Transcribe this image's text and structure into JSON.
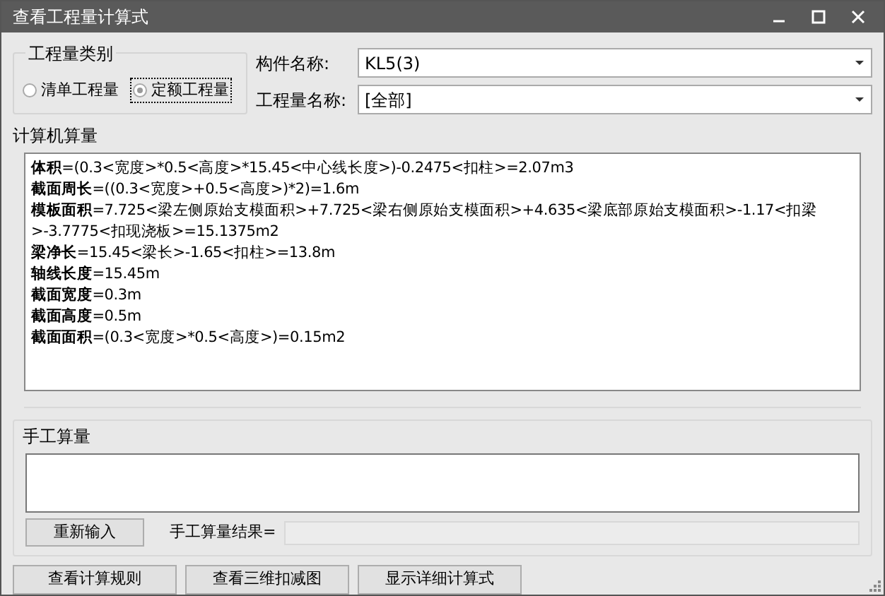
{
  "window": {
    "title": "查看工程量计算式"
  },
  "quantity_type": {
    "label": "工程量类别",
    "options": [
      {
        "label": "清单工程量",
        "selected": false
      },
      {
        "label": "定额工程量",
        "selected": true
      }
    ]
  },
  "fields": [
    {
      "label": "构件名称:",
      "value": "KL5(3)"
    },
    {
      "label": "工程量名称:",
      "value": "[全部]"
    }
  ],
  "computer_calc": {
    "label": "计算机算量",
    "lines": [
      "**体积**=(0.3<宽度>*0.5<高度>*15.45<中心线长度>)-0.2475<扣柱>=2.07m3",
      "**截面周长**=((0.3<宽度>+0.5<高度>)*2)=1.6m",
      "**模板面积**=7.725<梁左侧原始支模面积>+7.725<梁右侧原始支模面积>+4.635<梁底部原始支模面积>-1.17<扣梁>-3.7775<扣现浇板>=15.1375m2",
      "**梁净长**=15.45<梁长>-1.65<扣柱>=13.8m",
      "**轴线长度**=15.45m",
      "**截面宽度**=0.3m",
      "**截面高度**=0.5m",
      "**截面面积**=(0.3<宽度>*0.5<高度>)=0.15m2"
    ]
  },
  "manual_calc": {
    "label": "手工算量",
    "reenter_button": "重新输入",
    "result_label": "手工算量结果="
  },
  "buttons": [
    "查看计算规则",
    "查看三维扣减图",
    "显示详细计算式"
  ]
}
